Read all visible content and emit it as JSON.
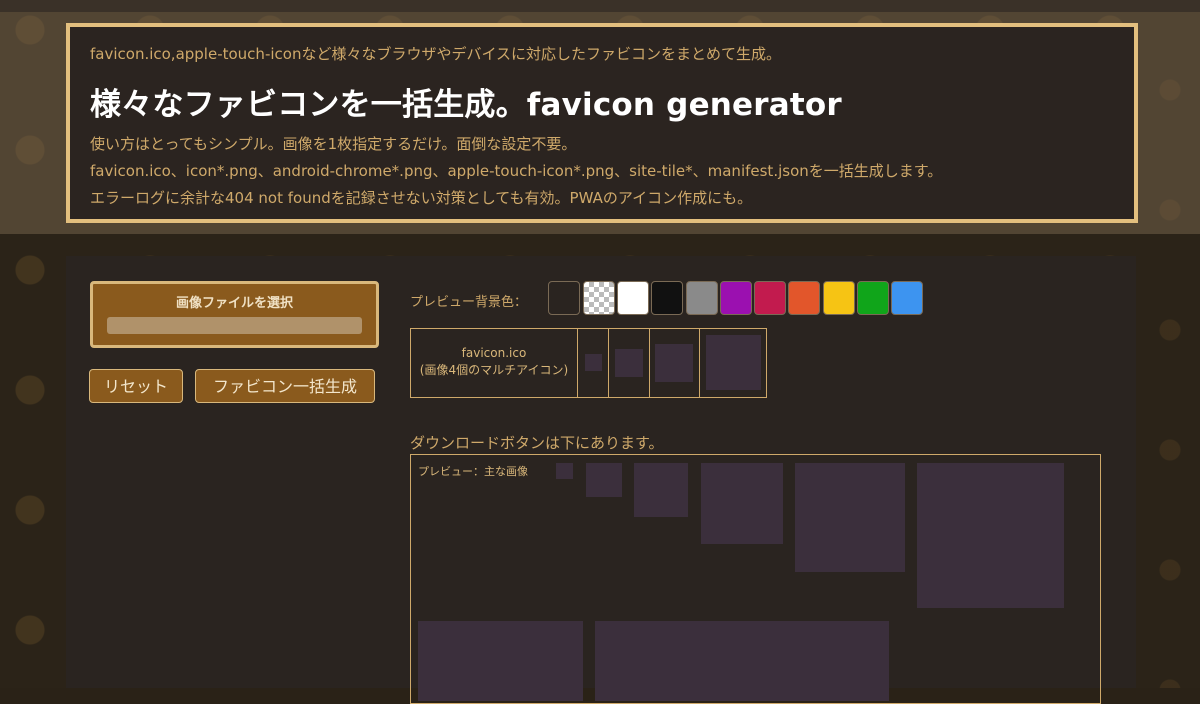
{
  "header": {
    "tagline": "favicon.ico,apple-touch-iconなど様々なブラウザやデバイスに対応したファビコンをまとめて生成。",
    "title": "様々なファビコンを一括生成。favicon generator",
    "desc": [
      "使い方はとってもシンプル。画像を1枚指定するだけ。面倒な設定不要。",
      "favicon.ico、icon*.png、android-chrome*.png、apple-touch-icon*.png、site-tile*、manifest.jsonを一括生成します。",
      "エラーログに余計な404 not foundを記録させない対策としても有効。PWAのアイコン作成にも。"
    ]
  },
  "controls": {
    "file_select_label": "画像ファイルを選択",
    "reset_label": "リセット",
    "generate_label": "ファビコン一括生成"
  },
  "preview_bg": {
    "label": "プレビュー背景色：",
    "swatches": [
      {
        "name": "transparent-dark",
        "color": "#2a2420"
      },
      {
        "name": "checker",
        "color": "checker"
      },
      {
        "name": "white",
        "color": "#ffffff"
      },
      {
        "name": "black",
        "color": "#111111"
      },
      {
        "name": "gray",
        "color": "#8a8a8a"
      },
      {
        "name": "purple",
        "color": "#9b10b0"
      },
      {
        "name": "crimson",
        "color": "#c21b4e"
      },
      {
        "name": "orange",
        "color": "#e2562b"
      },
      {
        "name": "yellow",
        "color": "#f6c414"
      },
      {
        "name": "green",
        "color": "#10a51a"
      },
      {
        "name": "blue",
        "color": "#3d94f0"
      }
    ]
  },
  "ico": {
    "name": "favicon.ico",
    "note": "(画像4個のマルチアイコン)"
  },
  "download_note": "ダウンロードボタンは下にあります。",
  "preview": {
    "label": "プレビュー：主な画像"
  },
  "colors": {
    "accent": "#e3bf7e",
    "button": "#8a5a1d",
    "placeholder": "#3b2f3c"
  }
}
